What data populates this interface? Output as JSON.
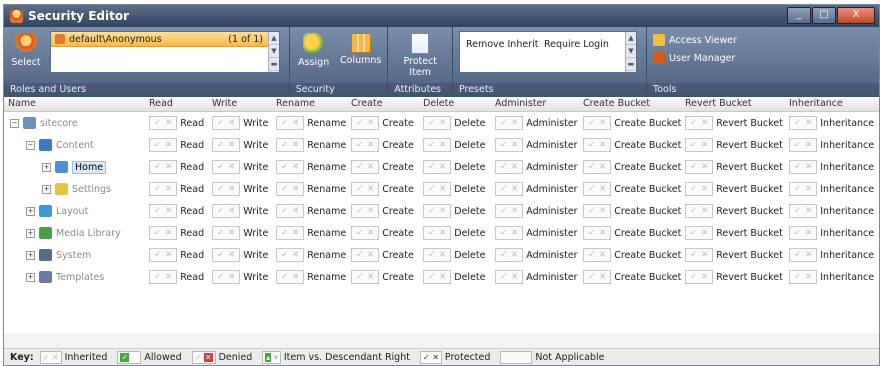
{
  "window": {
    "title": "Security Editor",
    "controls": [
      "_",
      "□",
      "X"
    ]
  },
  "ribbon": {
    "roles": {
      "select_label": "Select",
      "selected_user": "default\\Anonymous",
      "count": "(1 of 1)",
      "group_label": "Roles and Users"
    },
    "security": {
      "assign_label": "Assign",
      "columns_label": "Columns",
      "group_label": "Security"
    },
    "attributes": {
      "protect_label": "Protect Item",
      "group_label": "Attributes"
    },
    "presets": {
      "items": [
        "Remove Inherit",
        "Require Login"
      ],
      "group_label": "Presets"
    },
    "tools": {
      "items": [
        "Access Viewer",
        "User Manager"
      ],
      "group_label": "Tools"
    }
  },
  "grid": {
    "columns": [
      "Name",
      "Read",
      "Write",
      "Rename",
      "Create",
      "Delete",
      "Administer",
      "Create Bucket",
      "Revert Bucket",
      "Inheritance"
    ],
    "rows": [
      {
        "name": "sitecore",
        "level": 0,
        "expander": "−",
        "icon": "page-icon",
        "color": "#6b8fc2"
      },
      {
        "name": "Content",
        "level": 1,
        "expander": "−",
        "icon": "content-icon",
        "color": "#3a78c8"
      },
      {
        "name": "Home",
        "level": 2,
        "expander": "+",
        "icon": "home-icon",
        "color": "#4d8fd6",
        "selected": true
      },
      {
        "name": "Settings",
        "level": 2,
        "expander": "+",
        "icon": "folder-icon",
        "color": "#e8c440"
      },
      {
        "name": "Layout",
        "level": 1,
        "expander": "+",
        "icon": "layout-icon",
        "color": "#3a9ad8"
      },
      {
        "name": "Media Library",
        "level": 1,
        "expander": "+",
        "icon": "media-icon",
        "color": "#4aa04a"
      },
      {
        "name": "System",
        "level": 1,
        "expander": "+",
        "icon": "system-icon",
        "color": "#5a6a8a"
      },
      {
        "name": "Templates",
        "level": 1,
        "expander": "+",
        "icon": "templates-icon",
        "color": "#6a7aa0"
      }
    ]
  },
  "key": {
    "label": "Key:",
    "items": [
      "Inherited",
      "Allowed",
      "Denied",
      "Item vs. Descendant Right",
      "Protected",
      "Not Applicable"
    ]
  }
}
